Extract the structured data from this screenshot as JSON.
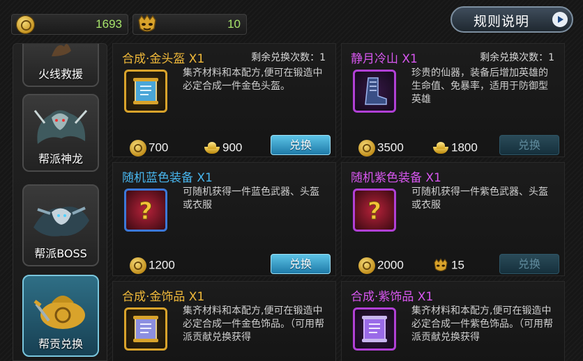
{
  "topbar": {
    "currency1": {
      "icon": "coin-icon",
      "value": "1693"
    },
    "currency2": {
      "icon": "mask-icon",
      "value": "10"
    },
    "rules_button": "规则说明"
  },
  "sidebar": {
    "items": [
      {
        "label": "火线救援",
        "active": false
      },
      {
        "label": "帮派神龙",
        "active": false
      },
      {
        "label": "帮派BOSS",
        "active": false
      },
      {
        "label": "帮贡兑换",
        "active": true
      }
    ]
  },
  "cards": [
    {
      "title": "合成·金头盔 X1",
      "title_color": "#f0b93a",
      "count": "剩余兑换次数：1",
      "desc": "集齐材料和本配方,便可在锻造中必定合成一件金色头盔。",
      "prices": [
        {
          "icon": "coin-icon",
          "value": "700"
        },
        {
          "icon": "ingot-icon",
          "value": "900"
        }
      ],
      "button": "兑换",
      "button_enabled": true
    },
    {
      "title": "静月冷山 X1",
      "title_color": "#d857f0",
      "count": "剩余兑换次数：1",
      "desc": "珍贵的仙器，装备后增加英雄的生命值、免暴率，适用于防御型英雄",
      "prices": [
        {
          "icon": "coin-icon",
          "value": "3500"
        },
        {
          "icon": "ingot-icon",
          "value": "1800"
        }
      ],
      "button": "兑换",
      "button_enabled": false
    },
    {
      "title": "随机蓝色装备 X1",
      "title_color": "#48b6ee",
      "count": "",
      "desc": "可随机获得一件蓝色武器、头盔或衣服",
      "prices": [
        {
          "icon": "coin-icon",
          "value": "1200"
        }
      ],
      "button": "兑换",
      "button_enabled": true
    },
    {
      "title": "随机紫色装备 X1",
      "title_color": "#d857f0",
      "count": "",
      "desc": "可随机获得一件紫色武器、头盔或衣服",
      "prices": [
        {
          "icon": "coin-icon",
          "value": "2000"
        },
        {
          "icon": "mask-icon",
          "value": "15"
        }
      ],
      "button": "兑换",
      "button_enabled": false
    },
    {
      "title": "合成·金饰品 X1",
      "title_color": "#f0b93a",
      "count": "",
      "desc": "集齐材料和本配方,便可在锻造中必定合成一件金色饰品。（可用帮派贡献兑换获得",
      "prices": [],
      "button": "",
      "button_enabled": true
    },
    {
      "title": "合成·紫饰品 X1",
      "title_color": "#d857f0",
      "count": "",
      "desc": "集齐材料和本配方,便可在锻造中必定合成一件紫色饰品。（可用帮派贡献兑换获得",
      "prices": [],
      "button": "",
      "button_enabled": true
    }
  ]
}
